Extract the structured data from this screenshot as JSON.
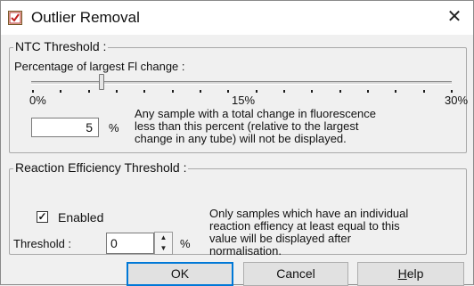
{
  "window": {
    "title": "Outlier Removal",
    "close_glyph": "✕"
  },
  "ntc": {
    "legend": "NTC Threshold :",
    "slider_label": "Percentage of largest Fl change :",
    "tick_min": "0%",
    "tick_mid": "15%",
    "tick_max": "30%",
    "slider_value_percent": 5,
    "value": "5",
    "unit": "%",
    "description_lines": [
      "Any sample with a total change in fluorescence",
      "less than this percent (relative to the largest",
      "change in any tube) will not be displayed."
    ]
  },
  "efficiency": {
    "legend": "Reaction Efficiency Threshold :",
    "enabled_label": "Enabled",
    "enabled": true,
    "threshold_label": "Threshold :",
    "threshold_value": "0",
    "unit": "%",
    "description_lines": [
      "Only samples which have an individual",
      "reaction effiency at least equal to this",
      "value will be displayed after",
      "normalisation."
    ]
  },
  "buttons": {
    "ok": "OK",
    "cancel": "Cancel",
    "help_mnemonic": "H",
    "help_rest": "elp"
  },
  "colors": {
    "focus_border": "#0078d7",
    "dialog_background": "#f0f0f0"
  },
  "icons": {
    "title": "app-dialog-icon",
    "close": "close-icon",
    "spin_up": "spin-up-icon",
    "spin_down": "spin-down-icon",
    "check": "checkmark-icon"
  }
}
